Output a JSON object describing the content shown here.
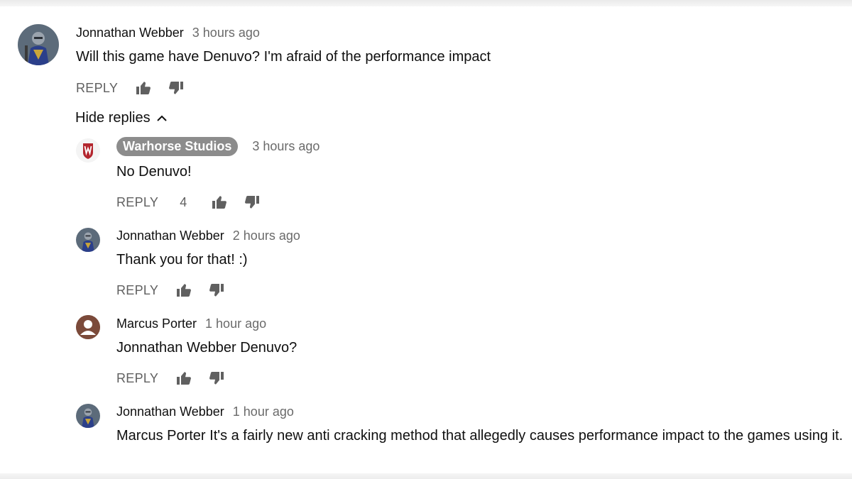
{
  "thread": {
    "top_comment": {
      "author": "Jonnathan Webber",
      "time": "3 hours ago",
      "text": "Will this game have Denuvo? I'm afraid of the performance impact",
      "reply_label": "REPLY"
    },
    "hide_replies_label": "Hide replies",
    "replies": [
      {
        "author": "Warhorse Studios",
        "time": "3 hours ago",
        "text": "No Denuvo!",
        "reply_label": "REPLY",
        "likes": "4"
      },
      {
        "author": "Jonnathan Webber",
        "time": "2 hours ago",
        "text": "Thank you for that! :)",
        "reply_label": "REPLY"
      },
      {
        "author": "Marcus Porter",
        "time": "1 hour ago",
        "text": "Jonnathan Webber Denuvo?",
        "reply_label": "REPLY"
      },
      {
        "author": "Jonnathan Webber",
        "time": "1 hour ago",
        "text": "Marcus Porter It's a fairly new anti cracking method that allegedly causes performance impact to the games using it."
      }
    ]
  },
  "icons": {
    "like": "thumbs-up-icon",
    "dislike": "thumbs-down-icon",
    "chevron": "chevron-up-icon"
  },
  "colors": {
    "owner_badge": "#8c8c8c",
    "secondary_text": "#606060",
    "warhorse_red": "#b3262e"
  }
}
